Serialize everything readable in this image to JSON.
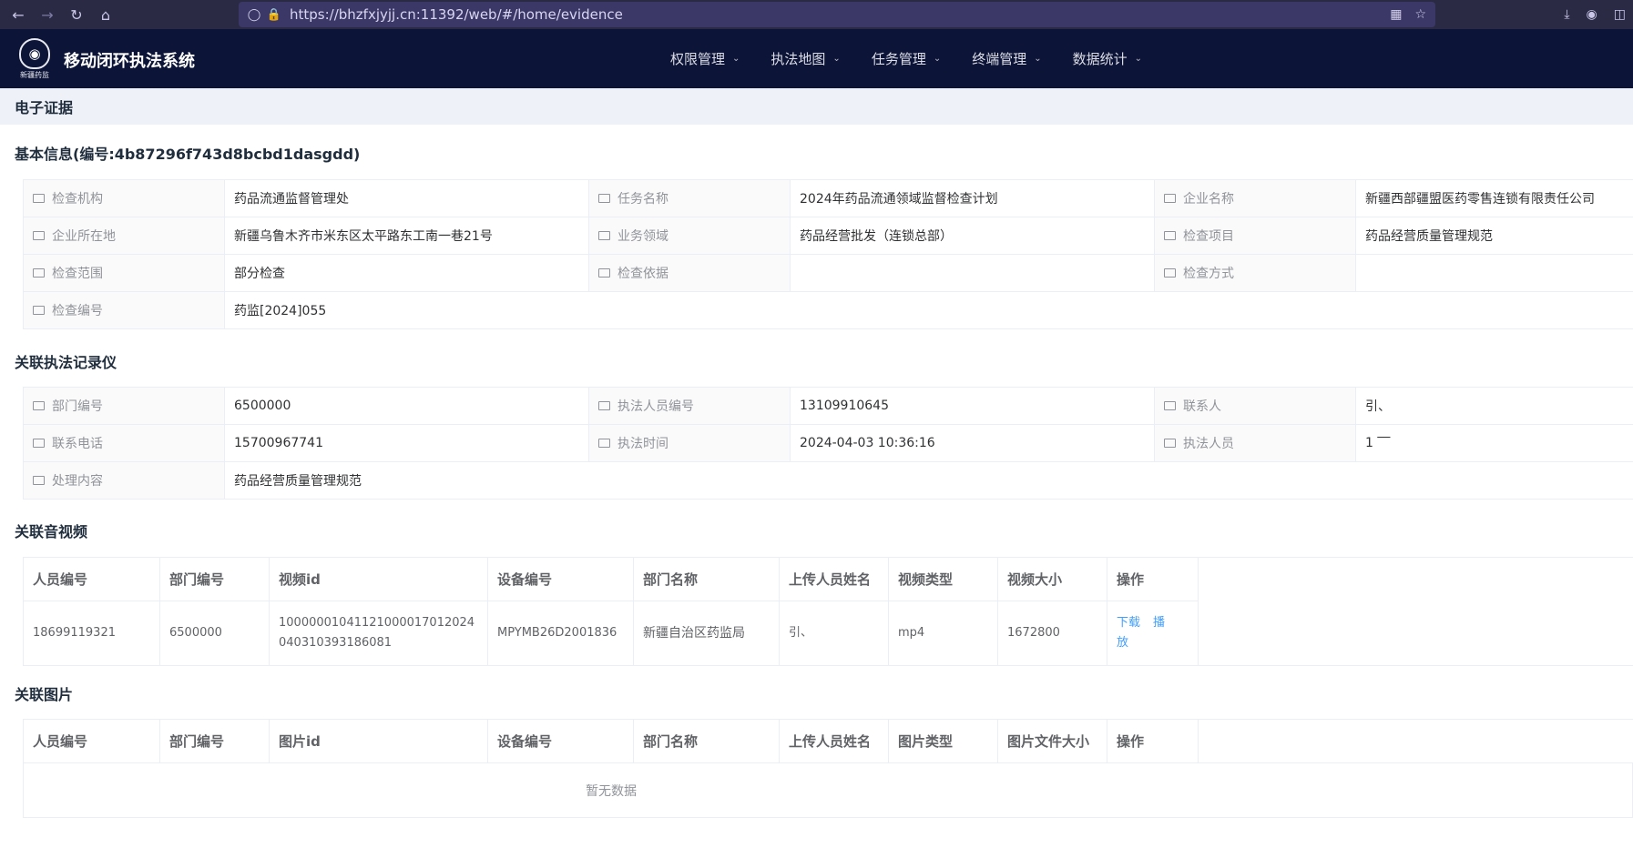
{
  "browser": {
    "url": "https://bhzfxjyjj.cn:11392/web/#/home/evidence",
    "icons": [
      "back-icon",
      "forward-icon",
      "reload-icon",
      "home-icon",
      "shield-icon",
      "lock-icon",
      "qr-icon",
      "star-icon",
      "download-icon",
      "account-icon",
      "extensions-icon"
    ]
  },
  "header": {
    "logo_text": "新疆药监",
    "title": "移动闭环执法系统",
    "nav": [
      "权限管理",
      "执法地图",
      "任务管理",
      "终端管理",
      "数据统计"
    ]
  },
  "breadcrumb": {
    "title": "电子证据"
  },
  "basic": {
    "title": "基本信息(编号:4b87296f743d8bcbd1dasgdd)",
    "rows": [
      [
        {
          "label": "检查机构",
          "value": "药品流通监督管理处"
        },
        {
          "label": "任务名称",
          "value": "2024年药品流通领域监督检查计划"
        },
        {
          "label": "企业名称",
          "value": "新疆西部疆盟医药零售连锁有限责任公司"
        }
      ],
      [
        {
          "label": "企业所在地",
          "value": "新疆乌鲁木齐市米东区太平路东工南一巷21号"
        },
        {
          "label": "业务领域",
          "value": "药品经营批发（连锁总部）"
        },
        {
          "label": "检查项目",
          "value": "药品经营质量管理规范"
        }
      ],
      [
        {
          "label": "检查范围",
          "value": "部分检查"
        },
        {
          "label": "检查依据",
          "value": ""
        },
        {
          "label": "检查方式",
          "value": ""
        }
      ],
      [
        {
          "label": "检查编号",
          "value": "药监[2024]055"
        }
      ]
    ]
  },
  "recorder": {
    "title": "关联执法记录仪",
    "rows": [
      [
        {
          "label": "部门编号",
          "value": "6500000"
        },
        {
          "label": "执法人员编号",
          "value": "13109910645"
        },
        {
          "label": "联系人",
          "value": "引、"
        }
      ],
      [
        {
          "label": "联系电话",
          "value": "15700967741"
        },
        {
          "label": "执法时间",
          "value": "2024-04-03 10:36:16"
        },
        {
          "label": "执法人员",
          "value": "1 ‾‾"
        }
      ],
      [
        {
          "label": "处理内容",
          "value": "药品经营质量管理规范"
        }
      ]
    ]
  },
  "videos": {
    "title": "关联音视频",
    "columns": [
      "人员编号",
      "部门编号",
      "视频id",
      "设备编号",
      "部门名称",
      "上传人员姓名",
      "视频类型",
      "视频大小",
      "操作"
    ],
    "rows": [
      {
        "person_id": "18699119321",
        "dept_id": "6500000",
        "video_id": "10000001041121000017012024040310393186081",
        "device_id": "MPYMB26D2001836",
        "dept_name": "新疆自治区药监局",
        "uploader": "引、",
        "type": "mp4",
        "size": "1672800"
      }
    ],
    "actions": [
      "下载",
      "播放"
    ]
  },
  "images": {
    "title": "关联图片",
    "columns": [
      "人员编号",
      "部门编号",
      "图片id",
      "设备编号",
      "部门名称",
      "上传人员姓名",
      "图片类型",
      "图片文件大小",
      "操作"
    ],
    "empty_text": "暂无数据"
  }
}
